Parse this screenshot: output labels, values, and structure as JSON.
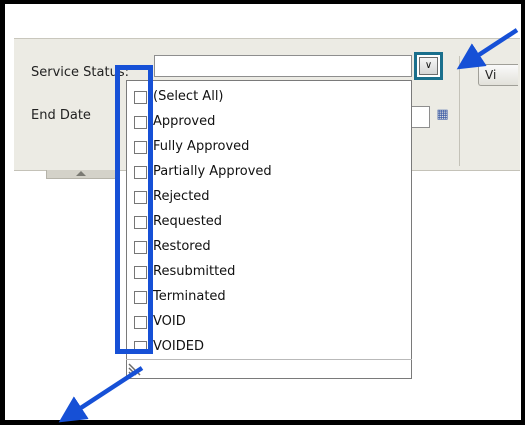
{
  "filter": {
    "service_status_label": "Service Status:",
    "end_date_label": "End Date",
    "view_button_label": "Vi",
    "dropdown_icon_glyph": "∨",
    "calendar_icon_glyph": "▦"
  },
  "dropdown": {
    "items": [
      {
        "label": "(Select All)",
        "checked": false
      },
      {
        "label": "Approved",
        "checked": false
      },
      {
        "label": "Fully Approved",
        "checked": false
      },
      {
        "label": "Partially Approved",
        "checked": false
      },
      {
        "label": "Rejected",
        "checked": false
      },
      {
        "label": "Requested",
        "checked": false
      },
      {
        "label": "Restored",
        "checked": false
      },
      {
        "label": "Resubmitted",
        "checked": false
      },
      {
        "label": "Terminated",
        "checked": false
      },
      {
        "label": "VOID",
        "checked": false
      },
      {
        "label": "VOIDED",
        "checked": false
      }
    ]
  },
  "annotations": {
    "highlight_color": "#1650d6",
    "button_highlight_color": "#1a6f8c"
  }
}
